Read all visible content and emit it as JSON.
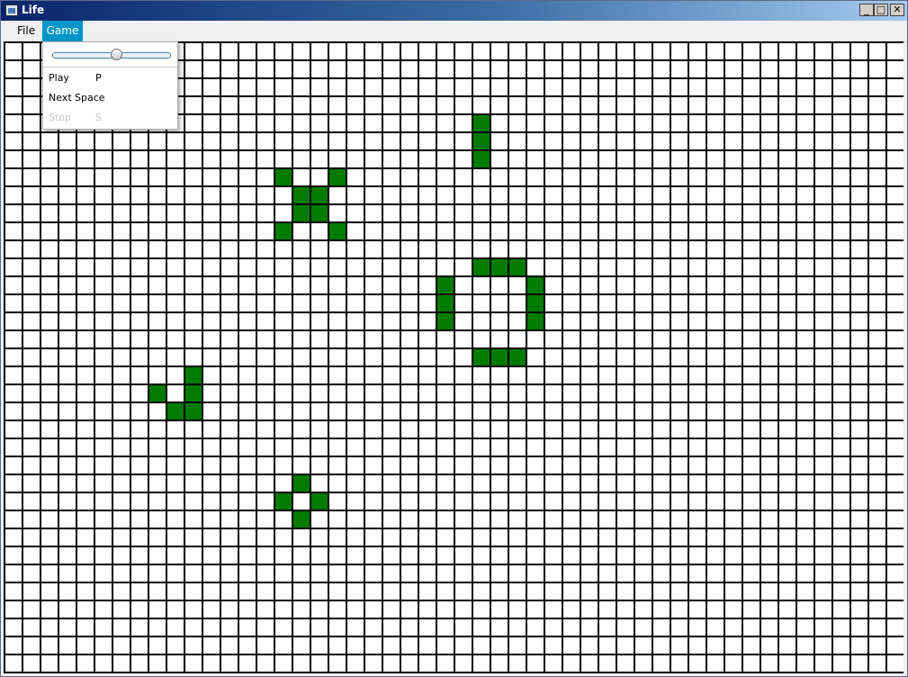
{
  "window": {
    "title": "Life",
    "minimize_glyph": "_",
    "maximize_glyph": "□",
    "close_glyph": "✕",
    "icon": "app-window-icon"
  },
  "menubar": {
    "items": [
      {
        "label": "File"
      },
      {
        "label": "Game",
        "active": true
      }
    ]
  },
  "game_menu": {
    "speed": 0.55,
    "items": [
      {
        "label": "Play",
        "shortcut": "P",
        "enabled": true
      },
      {
        "label": "Next",
        "shortcut": "Space",
        "enabled": true
      },
      {
        "label": "Stop",
        "shortcut": "S",
        "enabled": false
      }
    ]
  },
  "colors": {
    "live_cell": "#007a00",
    "dead_cell": "#ffffff",
    "grid_line": "#000000",
    "menu_highlight": "#0096c9"
  },
  "board": {
    "cols": 50,
    "rows": 35,
    "live_cells": [
      [
        26,
        4
      ],
      [
        26,
        5
      ],
      [
        26,
        6
      ],
      [
        15,
        7
      ],
      [
        18,
        7
      ],
      [
        16,
        8
      ],
      [
        17,
        8
      ],
      [
        16,
        9
      ],
      [
        17,
        9
      ],
      [
        15,
        10
      ],
      [
        18,
        10
      ],
      [
        26,
        12
      ],
      [
        27,
        12
      ],
      [
        28,
        12
      ],
      [
        24,
        13
      ],
      [
        29,
        13
      ],
      [
        24,
        14
      ],
      [
        29,
        14
      ],
      [
        24,
        15
      ],
      [
        29,
        15
      ],
      [
        26,
        17
      ],
      [
        27,
        17
      ],
      [
        28,
        17
      ],
      [
        10,
        18
      ],
      [
        8,
        19
      ],
      [
        10,
        19
      ],
      [
        9,
        20
      ],
      [
        10,
        20
      ],
      [
        16,
        24
      ],
      [
        15,
        25
      ],
      [
        17,
        25
      ],
      [
        16,
        26
      ]
    ]
  }
}
